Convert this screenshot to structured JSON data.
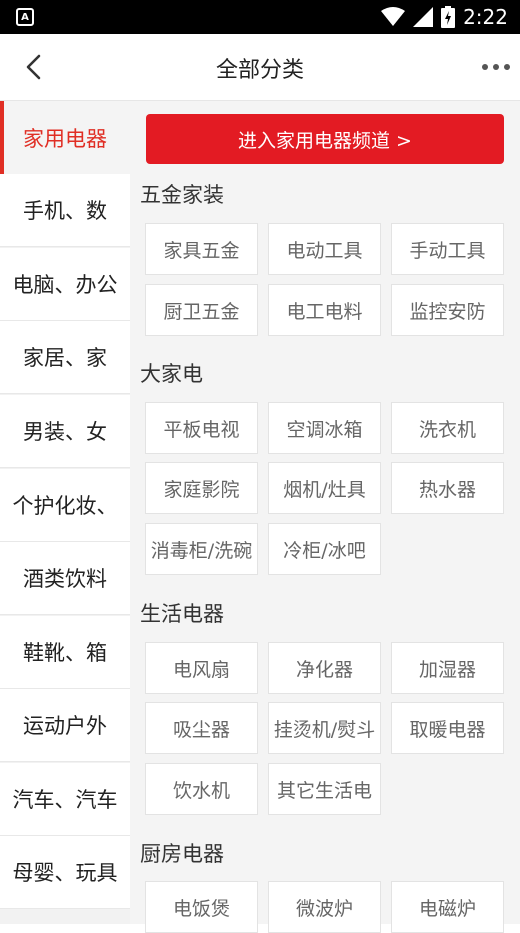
{
  "status_bar": {
    "time": "2:22",
    "app_badge": "A"
  },
  "header": {
    "title": "全部分类"
  },
  "sidebar": {
    "items": [
      {
        "label": "家用电器"
      },
      {
        "label": "手机、数"
      },
      {
        "label": "电脑、办公"
      },
      {
        "label": "家居、家"
      },
      {
        "label": "男装、女"
      },
      {
        "label": "个护化妆、"
      },
      {
        "label": "酒类饮料"
      },
      {
        "label": "鞋靴、箱"
      },
      {
        "label": "运动户外"
      },
      {
        "label": "汽车、汽车"
      },
      {
        "label": "母婴、玩具"
      }
    ]
  },
  "main": {
    "banner": "进入家用电器频道 >",
    "sections": [
      {
        "title": "五金家装",
        "items": [
          "家具五金",
          "电动工具",
          "手动工具",
          "厨卫五金",
          "电工电料",
          "监控安防"
        ]
      },
      {
        "title": "大家电",
        "items": [
          "平板电视",
          "空调冰箱",
          "洗衣机",
          "家庭影院",
          "烟机/灶具",
          "热水器",
          "消毒柜/洗碗",
          "冷柜/冰吧"
        ]
      },
      {
        "title": "生活电器",
        "items": [
          "电风扇",
          "净化器",
          "加湿器",
          "吸尘器",
          "挂烫机/熨斗",
          "取暖电器",
          "饮水机",
          "其它生活电"
        ]
      },
      {
        "title": "厨房电器",
        "items": [
          "电饭煲",
          "微波炉",
          "电磁炉"
        ]
      }
    ]
  },
  "colors": {
    "accent": "#e31b23",
    "active_text": "#e02e24"
  }
}
